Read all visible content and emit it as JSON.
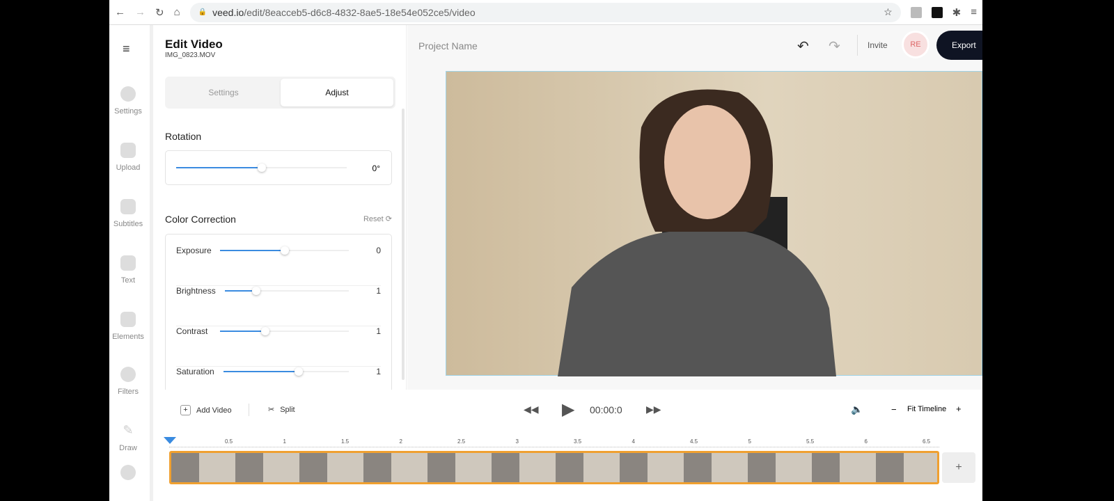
{
  "browser": {
    "url_host": "veed.io",
    "url_path": "/edit/8eacceb5-d6c8-4832-8ae5-18e54e052ce5/video"
  },
  "nav": [
    {
      "label": "Settings"
    },
    {
      "label": "Upload"
    },
    {
      "label": "Subtitles"
    },
    {
      "label": "Text"
    },
    {
      "label": "Elements"
    },
    {
      "label": "Filters"
    },
    {
      "label": "Draw"
    }
  ],
  "panel": {
    "title": "Edit Video",
    "filename": "IMG_0823.MOV",
    "tabs": [
      "Settings",
      "Adjust"
    ],
    "active_tab": "Adjust",
    "rotation": {
      "label": "Rotation",
      "value": "0°",
      "level": 0.5
    },
    "color": {
      "label": "Color Correction",
      "reset": "Reset",
      "rows": [
        {
          "label": "Exposure",
          "value": "0",
          "level": 0.5
        },
        {
          "label": "Brightness",
          "value": "1",
          "level": 0.25
        },
        {
          "label": "Contrast",
          "value": "1",
          "level": 0.35
        },
        {
          "label": "Saturation",
          "value": "1",
          "level": 0.6
        }
      ]
    }
  },
  "header": {
    "project_name": "Project Name",
    "invite": "Invite",
    "avatar": "RE",
    "export": "Export"
  },
  "player": {
    "add_video": "Add Video",
    "split": "Split",
    "time": "00:00:0",
    "fit": "Fit Timeline",
    "plus": "+",
    "minus": "−"
  },
  "timeline": {
    "ticks": [
      "0.5",
      "1",
      "1.5",
      "2",
      "2.5",
      "3",
      "3.5",
      "4",
      "4.5",
      "5",
      "5.5",
      "6",
      "6.5"
    ],
    "add": "+"
  }
}
